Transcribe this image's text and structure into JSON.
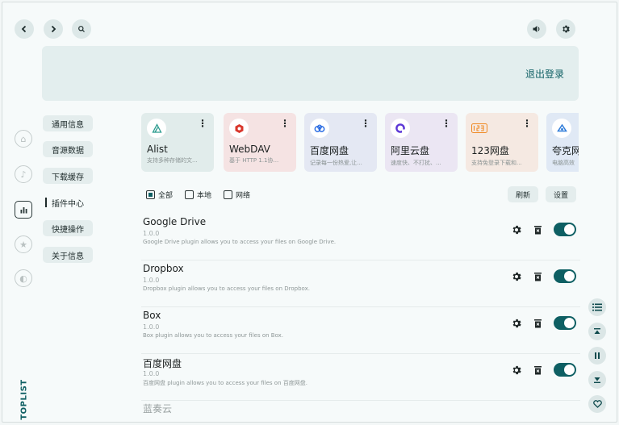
{
  "topbar": {
    "logout_label": "退出登录"
  },
  "menu": [
    {
      "label": "通用信息"
    },
    {
      "label": "音源数据"
    },
    {
      "label": "下载缓存"
    },
    {
      "label": "插件中心"
    },
    {
      "label": "快捷操作"
    },
    {
      "label": "关于信息"
    }
  ],
  "active_menu": "插件中心",
  "brand": "TOPLIST",
  "cards": [
    {
      "name": "Alist",
      "desc": "支持多种存储的文...",
      "logo_icon": "alist-icon",
      "bg": "#e1eceb"
    },
    {
      "name": "WebDAV",
      "desc": "基于 HTTP 1.1协...",
      "logo_icon": "webdav-icon",
      "bg": "#f5e3e3"
    },
    {
      "name": "百度网盘",
      "desc": "记录每一份热爱,让...",
      "logo_icon": "baidu-icon",
      "bg": "#e4e8f3"
    },
    {
      "name": "阿里云盘",
      "desc": "速度快、不打扰、...",
      "logo_icon": "aliyun-icon",
      "bg": "#ebe6f3"
    },
    {
      "name": "123网盘",
      "desc": "支持免登录下载和...",
      "logo_icon": "pan123-icon",
      "bg": "#f5e9e2"
    },
    {
      "name": "夸克网",
      "desc": "电脑高效",
      "logo_icon": "quark-icon",
      "bg": "#e0e9f5"
    }
  ],
  "filters": [
    {
      "label": "全部",
      "checked": true
    },
    {
      "label": "本地",
      "checked": false
    },
    {
      "label": "网络",
      "checked": false
    }
  ],
  "actions": {
    "refresh_label": "刷新",
    "settings_label": "设置"
  },
  "plugins": [
    {
      "title": "Google Drive",
      "version": "1.0.0",
      "desc": "Google Drive plugin allows you to access your files on Google Drive.",
      "enabled": true
    },
    {
      "title": "Dropbox",
      "version": "1.0.0",
      "desc": "Dropbox plugin allows you to access your files on Dropbox.",
      "enabled": true
    },
    {
      "title": "Box",
      "version": "1.0.0",
      "desc": "Box plugin allows you to access your files on Box.",
      "enabled": true
    },
    {
      "title": "百度网盘",
      "version": "1.0.0",
      "desc": "百度网盘 plugin allows you to access your files on 百度网盘.",
      "enabled": true
    },
    {
      "title": "蓝奏云",
      "version": "",
      "desc": "",
      "enabled": true
    }
  ],
  "colors": {
    "accent": "#0e5f63",
    "banner": "#e3eeee",
    "background": "#f6fafa"
  }
}
